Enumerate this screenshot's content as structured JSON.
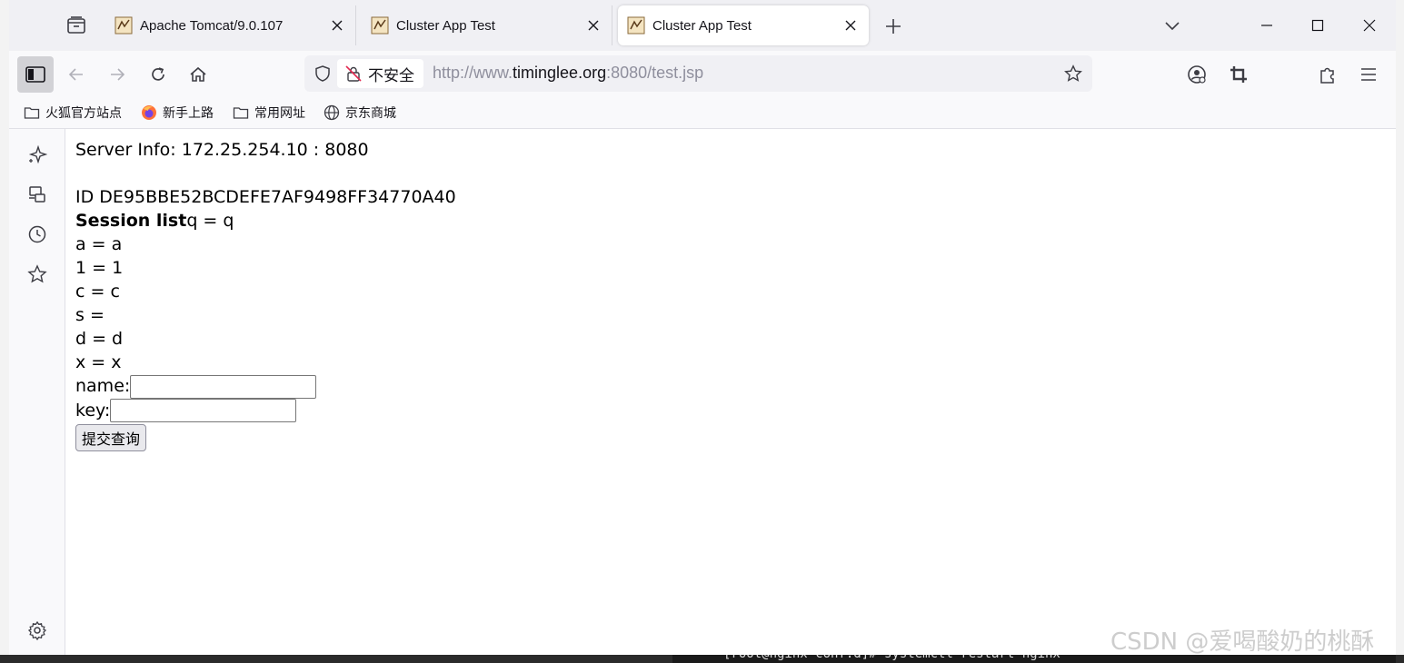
{
  "tabs": [
    {
      "title": "Apache Tomcat/9.0.107",
      "active": false
    },
    {
      "title": "Cluster App Test",
      "active": false
    },
    {
      "title": "Cluster App Test",
      "active": true
    }
  ],
  "urlbar": {
    "security_label": "不安全",
    "url_scheme": "http://www.",
    "url_host": "timinglee.org",
    "url_rest": ":8080/test.jsp"
  },
  "bookmarks": [
    {
      "label": "火狐官方站点",
      "icon": "folder-icon"
    },
    {
      "label": "新手上路",
      "icon": "firefox-icon"
    },
    {
      "label": "常用网址",
      "icon": "folder-icon"
    },
    {
      "label": "京东商城",
      "icon": "globe-icon"
    }
  ],
  "page": {
    "server_info": "Server Info: 172.25.254.10 : 8080",
    "session_id": "ID DE95BBE52BCDEFE7AF9498FF34770A40",
    "session_list_label": "Session list",
    "session_entries": [
      "q = q",
      "a = a",
      "1 = 1",
      "c = c",
      "s =",
      "d = d",
      "x = x"
    ],
    "name_label": "name:",
    "key_label": "key:",
    "submit_label": "提交查询"
  },
  "watermark": "CSDN @爱喝酸奶的桃酥",
  "terminal_text": "[root@nginx conf.d]# systemctl restart nginx"
}
